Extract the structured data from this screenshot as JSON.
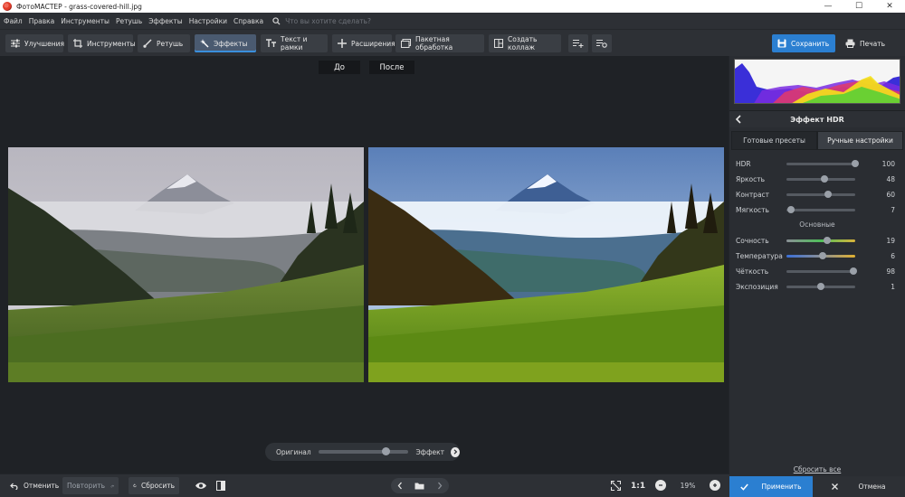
{
  "window": {
    "title": "ФотоМАСТЕР - grass-covered-hill.jpg",
    "minimize": "—",
    "maximize": "☐",
    "close": "✕"
  },
  "menu": {
    "items": [
      "Файл",
      "Правка",
      "Инструменты",
      "Ретушь",
      "Эффекты",
      "Настройки",
      "Справка"
    ],
    "search_placeholder": "Что вы хотите сделать?"
  },
  "toolbar": {
    "tabs": [
      "Улучшения",
      "Инструменты",
      "Ретушь",
      "Эффекты",
      "Текст и рамки",
      "Расширения"
    ],
    "active_tab": "Эффекты",
    "batch_label": "Пакетная обработка",
    "collage_label": "Создать коллаж",
    "save_label": "Сохранить",
    "print_label": "Печать"
  },
  "canvas": {
    "before_label": "До",
    "after_label": "После",
    "compare": {
      "left_label": "Оригинал",
      "right_label": "Эффект",
      "position": 0.75
    }
  },
  "panel": {
    "title": "Эффект HDR",
    "tabs": [
      "Готовые пресеты",
      "Ручные настройки"
    ],
    "active_tab": "Ручные настройки",
    "sliders_top": [
      {
        "label": "HDR",
        "value": "100",
        "level": 1.0
      },
      {
        "label": "Яркость",
        "value": "48",
        "level": 0.55
      },
      {
        "label": "Контраст",
        "value": "60",
        "level": 0.6
      },
      {
        "label": "Мягкость",
        "value": "7",
        "level": 0.07
      }
    ],
    "section_label": "Основные",
    "sliders_main": [
      {
        "label": "Сочность",
        "value": "19",
        "level": 0.59
      },
      {
        "label": "Температура",
        "value": "6",
        "level": 0.53
      },
      {
        "label": "Чёткость",
        "value": "98",
        "level": 0.97
      },
      {
        "label": "Экспозиция",
        "value": "1",
        "level": 0.5
      }
    ],
    "reset_all": "Сбросить все",
    "apply_label": "Применить",
    "cancel_label": "Отмена"
  },
  "bottombar": {
    "undo_label": "Отменить",
    "redo_label": "Повторить",
    "reset_label": "Сбросить",
    "ratio_label": "1:1",
    "zoom_value": "19%"
  },
  "colors": {
    "accent": "#2b7fd1",
    "bg_dark": "#1f2226",
    "panel_bg": "#2a2d32",
    "toolbar_bg": "#2d3035"
  }
}
